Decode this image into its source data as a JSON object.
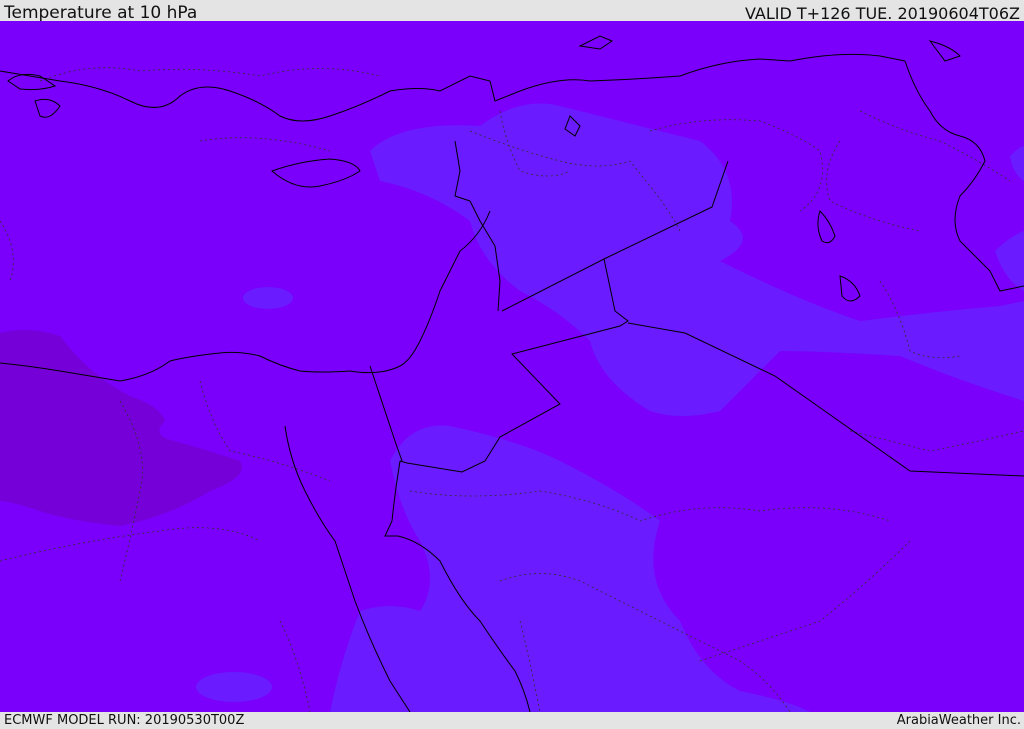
{
  "header": {
    "title": "Temperature at 10 hPa",
    "valid_time": "VALID T+126 TUE. 20190604T06Z"
  },
  "footer": {
    "model_run": "ECMWF MODEL RUN: 20190530T00Z",
    "credit": "ArabiaWeather Inc."
  },
  "colors": {
    "base_fill": "#7b00fb",
    "cool_band": "#6a1bff",
    "warm_patch": "#7600d8",
    "coastline": "#000000"
  }
}
